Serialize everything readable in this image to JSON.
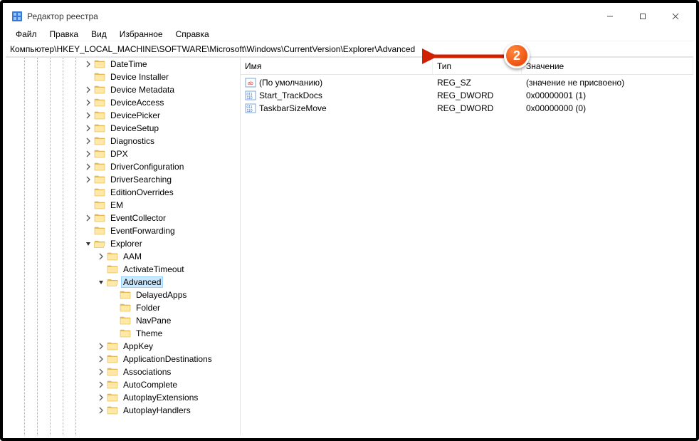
{
  "window": {
    "title": "Редактор реестра"
  },
  "menu": {
    "items": [
      "Файл",
      "Правка",
      "Вид",
      "Избранное",
      "Справка"
    ]
  },
  "address": {
    "path": "Компьютер\\HKEY_LOCAL_MACHINE\\SOFTWARE\\Microsoft\\Windows\\CurrentVersion\\Explorer\\Advanced"
  },
  "tree": {
    "items": [
      {
        "indent": 5,
        "expander": ">",
        "label": "DateTime"
      },
      {
        "indent": 5,
        "expander": "",
        "label": "Device Installer"
      },
      {
        "indent": 5,
        "expander": ">",
        "label": "Device Metadata"
      },
      {
        "indent": 5,
        "expander": ">",
        "label": "DeviceAccess"
      },
      {
        "indent": 5,
        "expander": ">",
        "label": "DevicePicker"
      },
      {
        "indent": 5,
        "expander": ">",
        "label": "DeviceSetup"
      },
      {
        "indent": 5,
        "expander": ">",
        "label": "Diagnostics"
      },
      {
        "indent": 5,
        "expander": ">",
        "label": "DPX"
      },
      {
        "indent": 5,
        "expander": ">",
        "label": "DriverConfiguration"
      },
      {
        "indent": 5,
        "expander": ">",
        "label": "DriverSearching"
      },
      {
        "indent": 5,
        "expander": "",
        "label": "EditionOverrides"
      },
      {
        "indent": 5,
        "expander": "",
        "label": "EM"
      },
      {
        "indent": 5,
        "expander": ">",
        "label": "EventCollector"
      },
      {
        "indent": 5,
        "expander": "",
        "label": "EventForwarding"
      },
      {
        "indent": 5,
        "expander": "v",
        "label": "Explorer",
        "open": true
      },
      {
        "indent": 6,
        "expander": ">",
        "label": "AAM"
      },
      {
        "indent": 6,
        "expander": "",
        "label": "ActivateTimeout"
      },
      {
        "indent": 6,
        "expander": "v",
        "label": "Advanced",
        "selected": true,
        "open": true
      },
      {
        "indent": 7,
        "expander": "",
        "label": "DelayedApps"
      },
      {
        "indent": 7,
        "expander": "",
        "label": "Folder"
      },
      {
        "indent": 7,
        "expander": "",
        "label": "NavPane"
      },
      {
        "indent": 7,
        "expander": "",
        "label": "Theme"
      },
      {
        "indent": 6,
        "expander": ">",
        "label": "AppKey"
      },
      {
        "indent": 6,
        "expander": ">",
        "label": "ApplicationDestinations"
      },
      {
        "indent": 6,
        "expander": ">",
        "label": "Associations"
      },
      {
        "indent": 6,
        "expander": ">",
        "label": "AutoComplete"
      },
      {
        "indent": 6,
        "expander": ">",
        "label": "AutoplayExtensions"
      },
      {
        "indent": 6,
        "expander": ">",
        "label": "AutoplayHandlers"
      }
    ]
  },
  "list": {
    "columns": {
      "name": "Имя",
      "type": "Тип",
      "value": "Значение"
    },
    "rows": [
      {
        "icon": "sz",
        "name": "(По умолчанию)",
        "type": "REG_SZ",
        "value": "(значение не присвоено)"
      },
      {
        "icon": "dw",
        "name": "Start_TrackDocs",
        "type": "REG_DWORD",
        "value": "0x00000001 (1)"
      },
      {
        "icon": "dw",
        "name": "TaskbarSizeMove",
        "type": "REG_DWORD",
        "value": "0x00000000 (0)"
      }
    ]
  },
  "annotation": {
    "number": "2"
  }
}
